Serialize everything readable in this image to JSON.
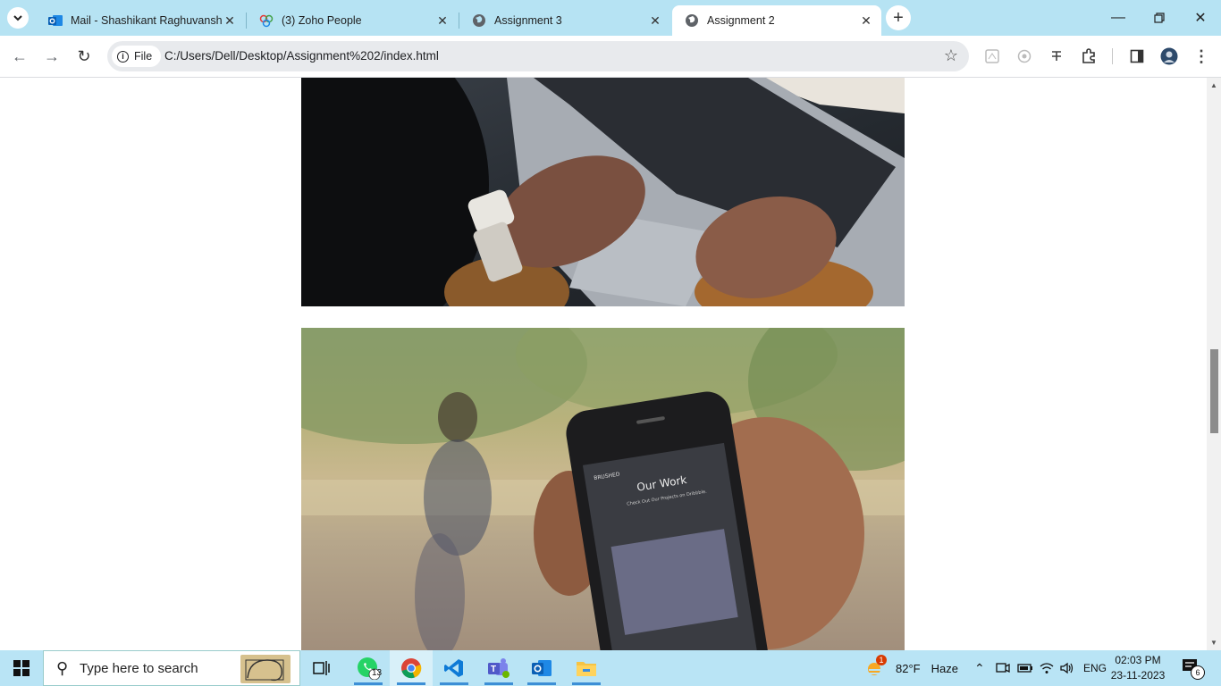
{
  "browser": {
    "tabs": [
      {
        "title": "Mail - Shashikant Raghuvanshi",
        "icon": "outlook-icon",
        "active": false
      },
      {
        "title": "(3) Zoho People",
        "icon": "zoho-icon",
        "active": false
      },
      {
        "title": "Assignment 3",
        "icon": "globe-icon",
        "active": false
      },
      {
        "title": "Assignment 2",
        "icon": "globe-icon",
        "active": true
      }
    ],
    "address": {
      "scheme_label": "File",
      "url": "C:/Users/Dell/Desktop/Assignment%202/index.html"
    }
  },
  "page": {
    "images": [
      {
        "name": "laptop-typing-image",
        "description_icon": "image"
      },
      {
        "name": "phone-in-hand-image",
        "phone_screen": {
          "brand": "BRUSHED",
          "heading": "Our Work",
          "subheading": "Check Out Our Projects on Dribbble."
        }
      }
    ]
  },
  "taskbar": {
    "search_placeholder": "Type here to search",
    "whatsapp_badge": "13",
    "weather": {
      "temp": "82°F",
      "condition": "Haze",
      "alert_badge": "1"
    },
    "language": "ENG",
    "time": "02:03 PM",
    "date": "23-11-2023",
    "notification_count": "6"
  },
  "colors": {
    "tabstrip": "#b6e3f3",
    "taskbar": "#b9e4f5",
    "accent": "#3d8fd6"
  }
}
